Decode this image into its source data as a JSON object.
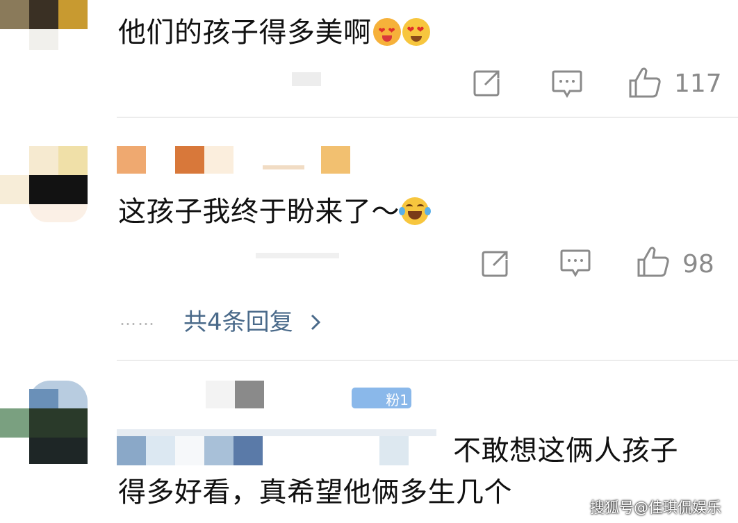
{
  "comments": [
    {
      "text": "他们的孩子得多美啊",
      "emojis": [
        "heart-eyes-tongue-emoji",
        "heart-eyes-emoji"
      ],
      "like_count": "117"
    },
    {
      "text": "这孩子我终于盼来了～",
      "emojis": [
        "laughing-tears-emoji"
      ],
      "like_count": "98",
      "replies_label": "共4条回复",
      "replies_dots": "……"
    },
    {
      "fan_badge": "粉1",
      "text_line1": "不敢想这俩人孩子",
      "text_line2": "得多好看，真希望他俩多生几个"
    }
  ],
  "watermark": "搜狐号@佳琪侃娱乐",
  "colors": {
    "link": "#4a6a8a",
    "icon": "#8a8a8a",
    "divider": "#ececec"
  }
}
